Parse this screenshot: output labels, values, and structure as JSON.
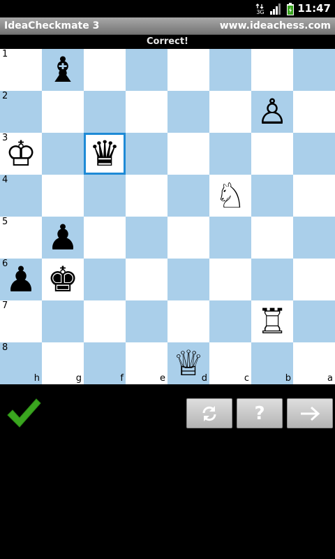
{
  "status_bar": {
    "time": "11:47",
    "network_label": "3G"
  },
  "title_bar": {
    "app_title": "IdeaCheckmate 3",
    "website": "www.ideachess.com"
  },
  "message": "Correct!",
  "board": {
    "rank_labels": [
      "1",
      "2",
      "3",
      "4",
      "5",
      "6",
      "7",
      "8"
    ],
    "file_labels": [
      "h",
      "g",
      "f",
      "e",
      "d",
      "c",
      "b",
      "a"
    ],
    "selected_square": {
      "row": 2,
      "col": 2
    },
    "pieces": [
      {
        "row": 0,
        "col": 1,
        "glyph": "♝",
        "name": "black-bishop-piece"
      },
      {
        "row": 1,
        "col": 6,
        "glyph": "♙",
        "name": "white-pawn-piece"
      },
      {
        "row": 2,
        "col": 0,
        "glyph": "♔",
        "name": "white-king-piece"
      },
      {
        "row": 2,
        "col": 2,
        "glyph": "♛",
        "name": "black-queen-piece"
      },
      {
        "row": 3,
        "col": 5,
        "glyph": "♘",
        "name": "white-knight-piece"
      },
      {
        "row": 4,
        "col": 1,
        "glyph": "♟",
        "name": "black-pawn-piece"
      },
      {
        "row": 5,
        "col": 0,
        "glyph": "♟",
        "name": "black-pawn-piece"
      },
      {
        "row": 5,
        "col": 1,
        "glyph": "♚",
        "name": "black-king-piece"
      },
      {
        "row": 6,
        "col": 6,
        "glyph": "♖",
        "name": "white-rook-piece"
      },
      {
        "row": 7,
        "col": 4,
        "glyph": "♕",
        "name": "white-queen-piece"
      }
    ]
  },
  "controls": {
    "hint_label": "?",
    "icons": [
      "checkmark-icon",
      "refresh-icon",
      "arrow-right-icon"
    ]
  },
  "colors": {
    "light_square": "#ffffff",
    "dark_square": "#aacfea",
    "selection": "#1e8ad6",
    "checkmark": "#3aa61f"
  }
}
